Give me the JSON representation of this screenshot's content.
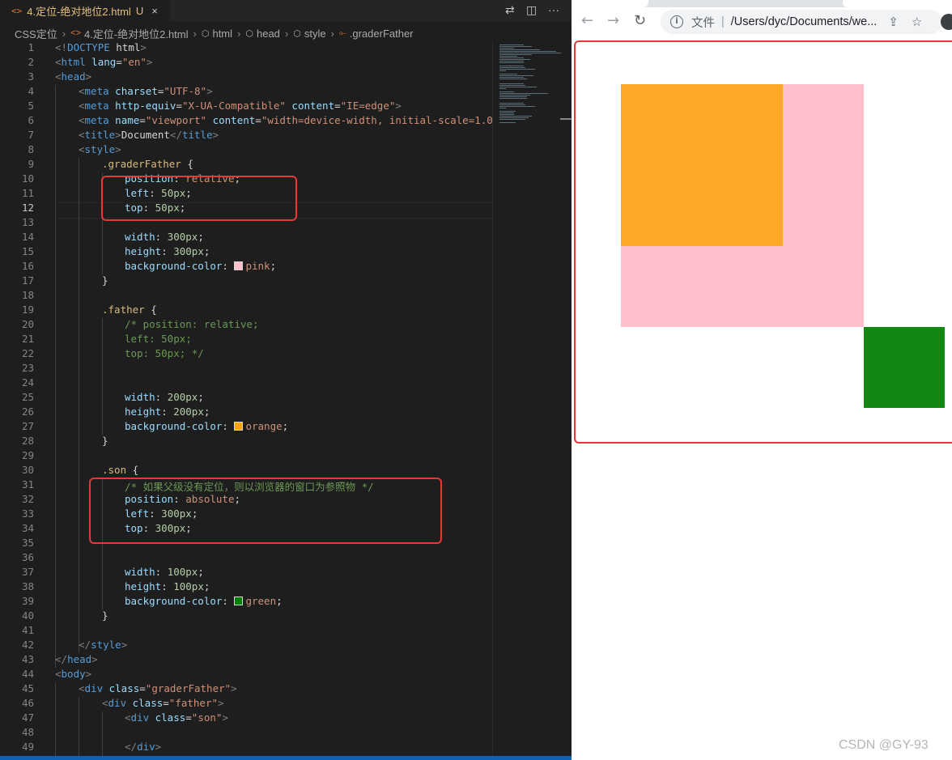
{
  "editor": {
    "tab": {
      "icon": "<>",
      "label": "4.定位-绝对地位2.html",
      "badge": "U",
      "close": "×"
    },
    "breadcrumb": [
      "CSS定位",
      "4.定位-绝对地位2.html",
      "html",
      "head",
      "style",
      ".graderFather"
    ],
    "current_line": 12,
    "line_numbers": [
      "1",
      "2",
      "3",
      "4",
      "5",
      "6",
      "7",
      "8",
      "9",
      "10",
      "11",
      "12",
      "13",
      "14",
      "15",
      "16",
      "17",
      "18",
      "19",
      "20",
      "21",
      "22",
      "23",
      "24",
      "25",
      "26",
      "27",
      "28",
      "29",
      "30",
      "31",
      "32",
      "33",
      "34",
      "35",
      "36",
      "37",
      "38",
      "39",
      "40",
      "41",
      "42",
      "43",
      "44",
      "45",
      "46",
      "47",
      "48",
      "49"
    ],
    "code": {
      "l1": {
        "a": "<!",
        "b": "DOCTYPE",
        "c": " html",
        "d": ">"
      },
      "l2": {
        "a": "<",
        "b": "html",
        "c": " lang",
        "d": "=",
        "e": "\"en\"",
        "f": ">"
      },
      "l3": {
        "a": "<",
        "b": "head",
        "c": ">"
      },
      "l4": {
        "a": "<",
        "b": "meta",
        "c": " charset",
        "d": "=",
        "e": "\"UTF-8\"",
        "f": ">"
      },
      "l5": {
        "a": "<",
        "b": "meta",
        "c": " http-equiv",
        "d": "=",
        "e": "\"X-UA-Compatible\"",
        "g": " content",
        "h": "=",
        "i": "\"IE=edge\"",
        "f": ">"
      },
      "l6": {
        "a": "<",
        "b": "meta",
        "c": " name",
        "d": "=",
        "e": "\"viewport\"",
        "g": " content",
        "h": "=",
        "i": "\"width=device-width, initial-scale=1.0\"",
        "f": ">"
      },
      "l7": {
        "a": "<",
        "b": "title",
        "c": ">",
        "d": "Document",
        "e": "</",
        "f": "title",
        "g": ">"
      },
      "l8": {
        "a": "<",
        "b": "style",
        "c": ">"
      },
      "l9": {
        "sel": ".graderFather",
        "br": " {"
      },
      "l10": {
        "p": "position",
        "c": ": ",
        "v": "relative",
        "e": ";"
      },
      "l11": {
        "p": "left",
        "c": ": ",
        "v": "50px",
        "e": ";"
      },
      "l12": {
        "p": "top",
        "c": ": ",
        "v": "50px",
        "e": ";"
      },
      "l14": {
        "p": "width",
        "c": ": ",
        "v": "300px",
        "e": ";"
      },
      "l15": {
        "p": "height",
        "c": ": ",
        "v": "300px",
        "e": ";"
      },
      "l16": {
        "p": "background-color",
        "c": ": ",
        "v": "pink",
        "e": ";"
      },
      "l17": "}",
      "l19": {
        "sel": ".father",
        "br": " {"
      },
      "l20": "/* position: relative;",
      "l21": "left: 50px;",
      "l22": "top: 50px; */",
      "l25": {
        "p": "width",
        "c": ": ",
        "v": "200px",
        "e": ";"
      },
      "l26": {
        "p": "height",
        "c": ": ",
        "v": "200px",
        "e": ";"
      },
      "l27": {
        "p": "background-color",
        "c": ": ",
        "v": "orange",
        "e": ";"
      },
      "l28": "}",
      "l30": {
        "sel": ".son",
        "br": " {"
      },
      "l31": "/* 如果父级没有定位，则以浏览器的窗口为参照物 */",
      "l32": {
        "p": "position",
        "c": ": ",
        "v": "absolute",
        "e": ";"
      },
      "l33": {
        "p": "left",
        "c": ": ",
        "v": "300px",
        "e": ";"
      },
      "l34": {
        "p": "top",
        "c": ": ",
        "v": "300px",
        "e": ";"
      },
      "l37": {
        "p": "width",
        "c": ": ",
        "v": "100px",
        "e": ";"
      },
      "l38": {
        "p": "height",
        "c": ": ",
        "v": "100px",
        "e": ";"
      },
      "l39": {
        "p": "background-color",
        "c": ": ",
        "v": "green",
        "e": ";"
      },
      "l40": "}",
      "l42": {
        "a": "</",
        "b": "style",
        "c": ">"
      },
      "l43": {
        "a": "</",
        "b": "head",
        "c": ">"
      },
      "l44": {
        "a": "<",
        "b": "body",
        "c": ">"
      },
      "l45": {
        "a": "<",
        "b": "div",
        "c": " class",
        "d": "=",
        "e": "\"graderFather\"",
        "f": ">"
      },
      "l46": {
        "a": "<",
        "b": "div",
        "c": " class",
        "d": "=",
        "e": "\"father\"",
        "f": ">"
      },
      "l47": {
        "a": "<",
        "b": "div",
        "c": " class",
        "d": "=",
        "e": "\"son\"",
        "f": ">"
      },
      "l49": {
        "a": "</",
        "b": "div",
        "c": ">"
      }
    },
    "swatch_colors": {
      "pink": "#ffc0cb",
      "orange": "#ffa500",
      "green": "#008000"
    },
    "highlight_color": "#e53935"
  },
  "browser": {
    "file_label": "文件",
    "url": "/Users/dyc/Documents/we...",
    "rendered_boxes": {
      "graderFather": {
        "color": "#ffc0cb"
      },
      "father": {
        "color": "#ffa729"
      },
      "son": {
        "color": "#128712"
      }
    }
  },
  "watermark": "CSDN @GY-93"
}
